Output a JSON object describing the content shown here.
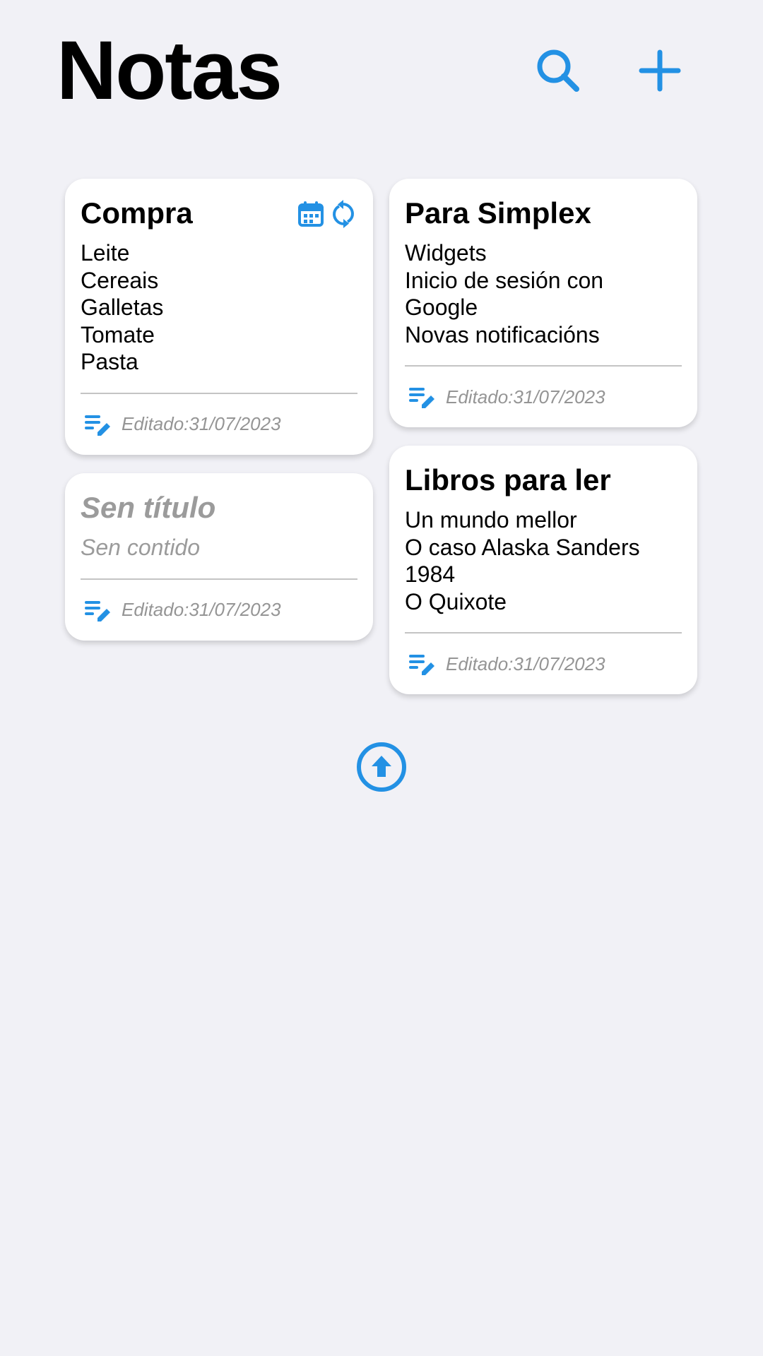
{
  "header": {
    "title": "Notas"
  },
  "notes": {
    "compra": {
      "title": "Compra",
      "lines": [
        "Leite",
        "Cereais",
        "Galletas",
        "Tomate",
        "Pasta"
      ],
      "edited": "Editado:31/07/2023"
    },
    "untitled": {
      "title": "Sen título",
      "lines": [
        "Sen contido"
      ],
      "edited": "Editado:31/07/2023"
    },
    "simplex": {
      "title": "Para Simplex",
      "lines": [
        "Widgets",
        "Inicio de sesión con",
        "Google",
        "Novas notificacións"
      ],
      "edited": "Editado:31/07/2023"
    },
    "libros": {
      "title": "Libros para ler",
      "lines": [
        "Un mundo mellor",
        "O caso Alaska Sanders",
        "1984",
        "O Quixote"
      ],
      "edited": "Editado:31/07/2023"
    }
  },
  "colors": {
    "accent": "#2391e4",
    "background": "#f1f1f6",
    "muted_text": "#959595"
  },
  "icons": {
    "search": "search-icon",
    "add": "plus-icon",
    "calendar": "calendar-icon",
    "sync": "sync-icon",
    "edit": "edit-note-icon",
    "scroll_top": "arrow-up-circle-icon"
  }
}
